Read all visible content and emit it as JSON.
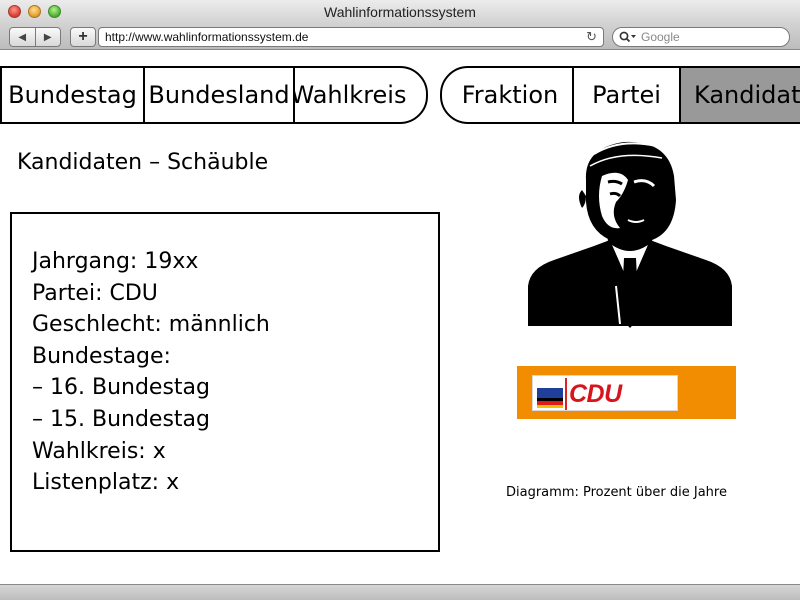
{
  "window": {
    "title": "Wahlinformationssystem"
  },
  "toolbar": {
    "back_label": "◀",
    "forward_label": "▶",
    "new_tab_label": "+",
    "url": "http://www.wahlinformationssystem.de",
    "search_placeholder": "Google",
    "icons": [
      "reload-icon",
      "search-icon"
    ]
  },
  "nav": {
    "left_tabs": [
      {
        "label": "Bundestag"
      },
      {
        "label": "Bundesland"
      },
      {
        "label": "Wahlkreis"
      }
    ],
    "right_tabs": [
      {
        "label": "Fraktion"
      },
      {
        "label": "Partei"
      },
      {
        "label": "Kandidat",
        "active": true
      }
    ],
    "active_color": "#999999"
  },
  "main": {
    "title": "Kandidaten – Schäuble",
    "info_lines": [
      "Jahrgang: 19xx",
      "Partei: CDU",
      "Geschlecht: männlich",
      "Bundestage:",
      "– 16. Bundestag",
      "– 15. Bundestag",
      "Wahlkreis: x",
      "Listenplatz: x"
    ],
    "party_logo": {
      "text": "CDU",
      "background": "#f28c00",
      "text_color": "#d8141c"
    },
    "diagram_caption": "Diagramm: Prozent über die Jahre"
  }
}
